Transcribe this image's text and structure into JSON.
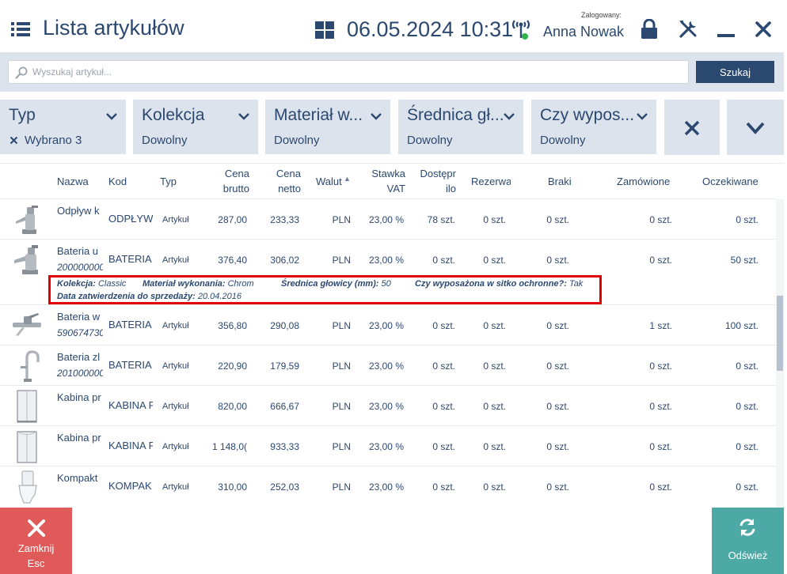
{
  "header": {
    "title": "Lista artykułów",
    "datetime": "06.05.2024 10:31",
    "logged_label": "Zalogowany:",
    "user": "Anna Nowak"
  },
  "search": {
    "placeholder": "Wyszukaj artykuł...",
    "value": "",
    "button": "Szukaj"
  },
  "filters": [
    {
      "title": "Typ",
      "value": "Wybrano 3",
      "has_clear": true
    },
    {
      "title": "Kolekcja",
      "value": "Dowolny"
    },
    {
      "title": "Materiał w...",
      "value": "Dowolny"
    },
    {
      "title": "Średnica gł...",
      "value": "Dowolny"
    },
    {
      "title": "Czy wypos...",
      "value": "Dowolny"
    }
  ],
  "columns": {
    "nazwa": "Nazwa",
    "kod": "Kod",
    "typ": "Typ",
    "cena_brutto": [
      "Cena",
      "brutto"
    ],
    "cena_netto": [
      "Cena",
      "netto"
    ],
    "waluta": "Walut",
    "vat": [
      "Stawka",
      "VAT"
    ],
    "dostepne": [
      "Dostępr",
      "ilo"
    ],
    "rezerwacje": "Rezerwa",
    "braki": "Braki",
    "zamowione": "Zamówione",
    "oczekiwane": "Oczekiwane"
  },
  "rows": [
    {
      "name": "Odpływ k",
      "sub": "",
      "kod": "ODPŁYW",
      "typ": "Artykuł",
      "brutto": "287,00",
      "netto": "233,33",
      "waluta": "PLN",
      "vat": "23,00 %",
      "dost": "78 szt.",
      "rez": "0 szt.",
      "braki": "0 szt.",
      "zam": "0 szt.",
      "ocz": "0 szt."
    },
    {
      "name": "Bateria u",
      "sub": "200000000",
      "kod": "BATERIA",
      "typ": "Artykuł",
      "brutto": "376,40",
      "netto": "306,02",
      "waluta": "PLN",
      "vat": "23,00 %",
      "dost": "0 szt.",
      "rez": "0 szt.",
      "braki": "0 szt.",
      "zam": "0 szt.",
      "ocz": "50 szt."
    },
    {
      "name": "Bateria w",
      "sub": "590674730",
      "kod": "BATERIA",
      "typ": "Artykuł",
      "brutto": "356,80",
      "netto": "290,08",
      "waluta": "PLN",
      "vat": "23,00 %",
      "dost": "0 szt.",
      "rez": "0 szt.",
      "braki": "0 szt.",
      "zam": "1 szt.",
      "ocz": "100 szt."
    },
    {
      "name": "Bateria zl",
      "sub": "201000000",
      "kod": "BATERIA",
      "typ": "Artykuł",
      "brutto": "220,90",
      "netto": "179,59",
      "waluta": "PLN",
      "vat": "23,00 %",
      "dost": "0 szt.",
      "rez": "0 szt.",
      "braki": "0 szt.",
      "zam": "0 szt.",
      "ocz": "0 szt."
    },
    {
      "name": "Kabina pr",
      "sub": "",
      "kod": "KABINA P",
      "typ": "Artykuł",
      "brutto": "820,00",
      "netto": "666,67",
      "waluta": "PLN",
      "vat": "23,00 %",
      "dost": "0 szt.",
      "rez": "0 szt.",
      "braki": "0 szt.",
      "zam": "0 szt.",
      "ocz": "0 szt."
    },
    {
      "name": "Kabina pr",
      "sub": "",
      "kod": "KABINA P",
      "typ": "Artykuł",
      "brutto": "1 148,0(",
      "netto": "933,33",
      "waluta": "PLN",
      "vat": "23,00 %",
      "dost": "0 szt.",
      "rez": "0 szt.",
      "braki": "0 szt.",
      "zam": "0 szt.",
      "ocz": "0 szt."
    },
    {
      "name": "Kompakt",
      "sub": "",
      "kod": "KOMPAK",
      "typ": "Artykuł",
      "brutto": "310,00",
      "netto": "252,03",
      "waluta": "PLN",
      "vat": "23,00 %",
      "dost": "0 szt.",
      "rez": "0 szt.",
      "braki": "0 szt.",
      "zam": "0 szt.",
      "ocz": "0 szt."
    }
  ],
  "details": {
    "kolekcja_label": "Kolekcja:",
    "kolekcja_value": "Classic",
    "material_label": "Materiał wykonania:",
    "material_value": "Chrom",
    "srednica_label": "Średnica głowicy (mm):",
    "srednica_value": "50",
    "sitko_label": "Czy wyposażona w sitko ochronne?:",
    "sitko_value": "Tak",
    "data_label": "Data zatwierdzenia do sprzedaży:",
    "data_value": "20.04.2016"
  },
  "footer": {
    "close_label": "Zamknij",
    "close_key": "Esc",
    "refresh_label": "Odśwież"
  },
  "colors": {
    "primary": "#2b4870",
    "panel": "#dde3ec",
    "close": "#e05a5a",
    "refresh": "#4ca9a6",
    "highlight": "#e00000"
  }
}
